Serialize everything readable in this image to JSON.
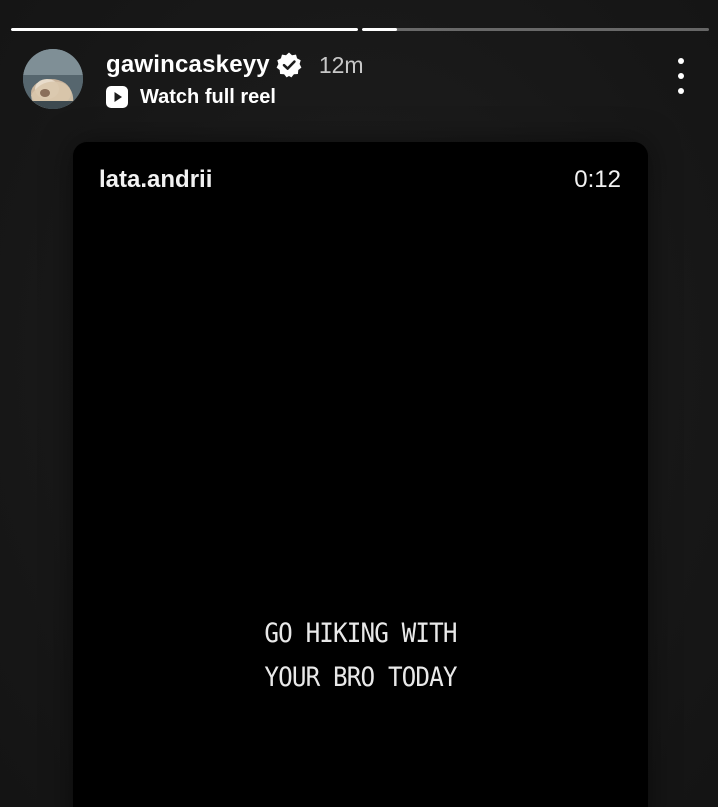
{
  "progress": {
    "segments": [
      1.0,
      0.1
    ]
  },
  "header": {
    "username": "gawincaskeyy",
    "time_ago": "12m",
    "reel_link_label": "Watch full reel",
    "avatar_icon": "avatar-photo",
    "verified_icon": "verified-badge-icon",
    "reel_icon": "play-icon",
    "more_icon": "more-vertical-icon"
  },
  "reel": {
    "username": "lata.andrii",
    "duration": "0:12",
    "caption_lines": [
      "GO HIKING WITH",
      "YOUR BRO TODAY"
    ]
  },
  "colors": {
    "background": "#1b1b1b",
    "card": "#000000",
    "text": "#ffffff",
    "muted_text": "#c8c8c8"
  }
}
